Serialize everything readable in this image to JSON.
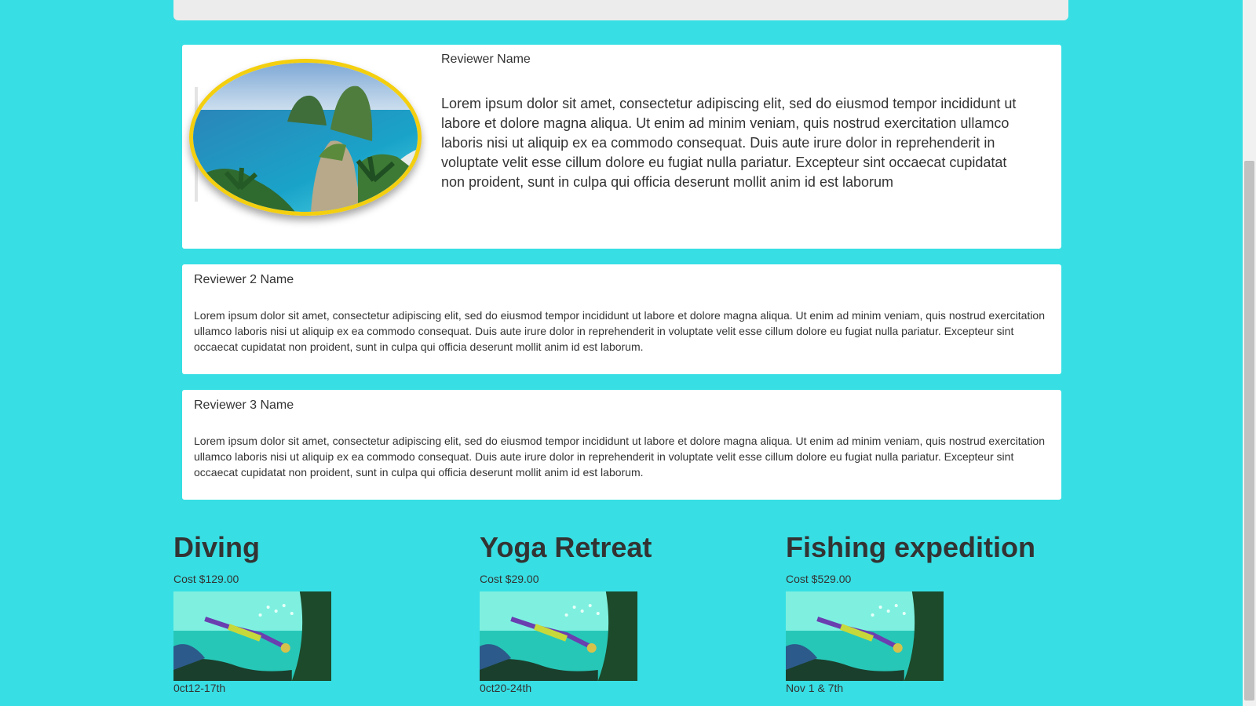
{
  "reviews": {
    "featured": {
      "name": "Reviewer Name",
      "text": "Lorem ipsum dolor sit amet, consectetur adipiscing elit, sed do eiusmod tempor incididunt ut labore et dolore magna aliqua. Ut enim ad minim veniam, quis nostrud exercitation ullamco laboris nisi ut aliquip ex ea commodo consequat. Duis aute irure dolor in reprehenderit in voluptate velit esse cillum dolore eu fugiat nulla pariatur. Excepteur sint occaecat cupidatat non proident, sunt in culpa qui officia deserunt mollit anim id est laborum",
      "image": "island-beach-photo"
    },
    "items": [
      {
        "name": "Reviewer 2 Name",
        "text": "Lorem ipsum dolor sit amet, consectetur adipiscing elit, sed do eiusmod tempor incididunt ut labore et dolore magna aliqua. Ut enim ad minim veniam, quis nostrud exercitation ullamco laboris nisi ut aliquip ex ea commodo consequat. Duis aute irure dolor in reprehenderit in voluptate velit esse cillum dolore eu fugiat nulla pariatur. Excepteur sint occaecat cupidatat non proident, sunt in culpa qui officia deserunt mollit anim id est laborum."
      },
      {
        "name": "Reviewer 3 Name",
        "text": "Lorem ipsum dolor sit amet, consectetur adipiscing elit, sed do eiusmod tempor incididunt ut labore et dolore magna aliqua. Ut enim ad minim veniam, quis nostrud exercitation ullamco laboris nisi ut aliquip ex ea commodo consequat. Duis aute irure dolor in reprehenderit in voluptate velit esse cillum dolore eu fugiat nulla pariatur. Excepteur sint occaecat cupidatat non proident, sunt in culpa qui officia deserunt mollit anim id est laborum."
      }
    ]
  },
  "activities": [
    {
      "title": "Diving",
      "cost": "Cost $129.00",
      "date": "0ct12-17th",
      "image": "diver-photo"
    },
    {
      "title": "Yoga Retreat",
      "cost": "Cost $29.00",
      "date": "0ct20-24th",
      "image": "diver-photo"
    },
    {
      "title": "Fishing expedition",
      "cost": "Cost $529.00",
      "date": "Nov 1 & 7th",
      "image": "diver-photo"
    }
  ],
  "colors": {
    "page_background": "#37dfe4",
    "card_background": "#ffffff",
    "frame_border": "#f3cf10"
  }
}
